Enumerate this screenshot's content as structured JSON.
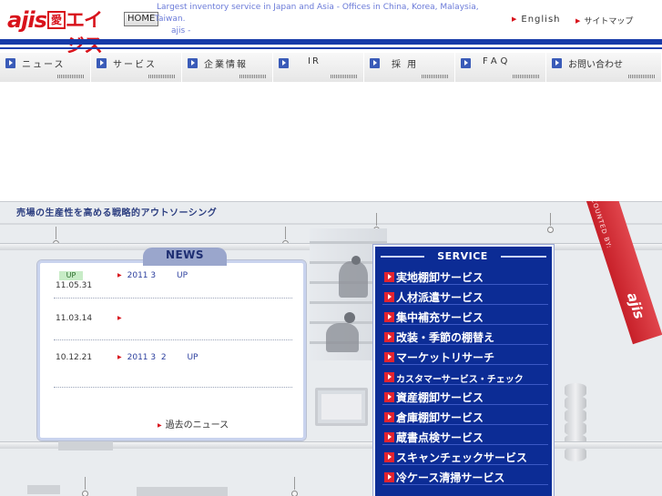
{
  "header": {
    "logo_latin": "ajis",
    "logo_kanji": "愛",
    "logo_kana": "エイジス",
    "home_button": "HOME",
    "tagline_line1": "Largest inventory service in Japan and Asia - Offices in China, Korea, Malaysia,",
    "tagline_line2": "Taiwan.",
    "tagline_line3": "ajis    -",
    "link_english": "English",
    "link_sitemap": "サイトマップ"
  },
  "nav": {
    "items": [
      {
        "label": "ニュース"
      },
      {
        "label": "サービス"
      },
      {
        "label": "企業情報"
      },
      {
        "label": "IR"
      },
      {
        "label": "採 用"
      },
      {
        "label": "FAQ"
      },
      {
        "label": "お問い合わせ"
      }
    ]
  },
  "scene": {
    "slogan": "売場の生産性を高める戦略的アウトソーシング"
  },
  "news": {
    "title": "NEWS",
    "items": [
      {
        "badge": "UP",
        "date": "11.05.31",
        "text": "2011 3        UP"
      },
      {
        "badge": "",
        "date": "11.03.14",
        "text": ""
      },
      {
        "badge": "",
        "date": "10.12.21",
        "text": "2011 3  2        UP"
      }
    ],
    "past_link": "過去のニュース"
  },
  "service": {
    "title": "SERVICE",
    "items": [
      {
        "label": "実地棚卸サービス",
        "small": false
      },
      {
        "label": "人材派遣サービス",
        "small": false
      },
      {
        "label": "集中補充サービス",
        "small": false
      },
      {
        "label": "改装・季節の棚替え",
        "small": false
      },
      {
        "label": "マーケットリサーチ",
        "small": false
      },
      {
        "label": "カスタマーサービス・チェック",
        "small": true
      },
      {
        "label": "資産棚卸サービス",
        "small": false
      },
      {
        "label": "倉庫棚卸サービス",
        "small": false
      },
      {
        "label": "蔵書点検サービス",
        "small": false
      },
      {
        "label": "スキャンチェックサービス",
        "small": false
      },
      {
        "label": "冷ケース清掃サービス",
        "small": false
      }
    ]
  },
  "ribbon": {
    "counted_by": "COUNTED BY:",
    "logo": "ajis"
  },
  "colors": {
    "brand_red": "#d8121b",
    "brand_blue": "#163aa8",
    "service_bg": "#0c2c95"
  },
  "icons": {
    "nav_bullet": "play-square-icon",
    "service_bullet": "red-play-square-icon",
    "link_arrow": "red-triangle-icon"
  }
}
